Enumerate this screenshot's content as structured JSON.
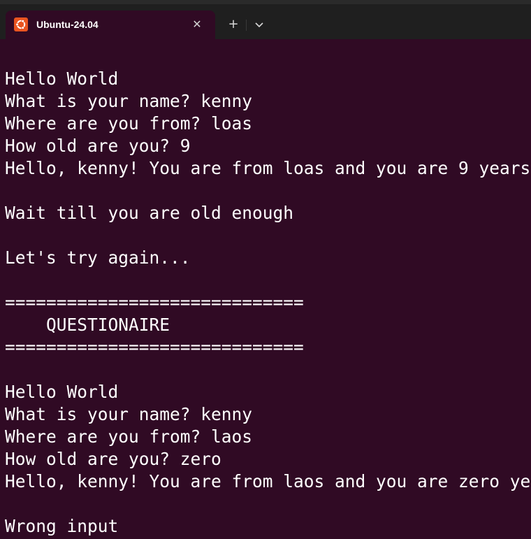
{
  "tab": {
    "title": "Ubuntu-24.04",
    "icon": "ubuntu-logo-icon",
    "close_label": "✕"
  },
  "toolbar": {
    "new_tab_label": "+",
    "dropdown_label": "⌄"
  },
  "colors": {
    "terminal_bg": "#300a24",
    "titlebar_bg": "#1f1f1f",
    "ubuntu_orange": "#e95420",
    "text": "#ffffff"
  },
  "terminal": {
    "lines": [
      "",
      "Hello World",
      "What is your name? kenny",
      "Where are you from? loas",
      "How old are you? 9",
      "Hello, kenny! You are from loas and you are 9 years",
      "",
      "Wait till you are old enough",
      "",
      "Let's try again...",
      "",
      "=============================",
      "    QUESTIONAIRE",
      "=============================",
      "",
      "Hello World",
      "What is your name? kenny",
      "Where are you from? laos",
      "How old are you? zero",
      "Hello, kenny! You are from laos and you are zero ye",
      "",
      "Wrong input"
    ]
  }
}
